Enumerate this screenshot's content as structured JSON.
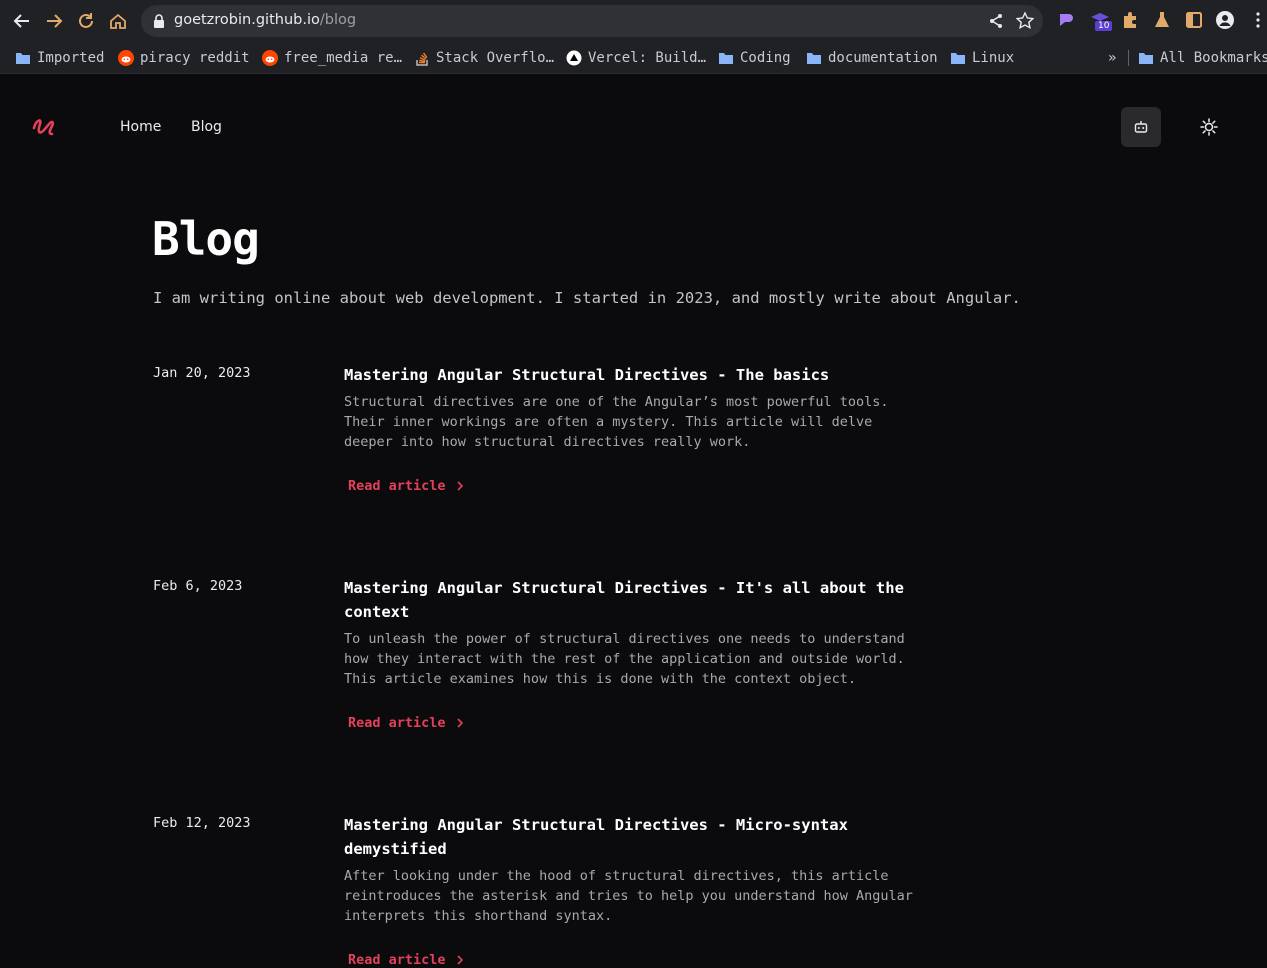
{
  "browser": {
    "url_host": "goetzrobin.github.io",
    "url_path": "/blog",
    "extension_badge": "10",
    "bookmarks": [
      {
        "label": "Imported",
        "icon": "folder-icon"
      },
      {
        "label": "piracy reddit",
        "icon": "reddit-icon"
      },
      {
        "label": "free_media re…",
        "icon": "reddit-icon"
      },
      {
        "label": "Stack Overflo…",
        "icon": "stackoverflow-icon"
      },
      {
        "label": "Vercel: Build…",
        "icon": "vercel-icon"
      },
      {
        "label": "Coding",
        "icon": "folder-icon"
      },
      {
        "label": "documentation",
        "icon": "folder-icon"
      },
      {
        "label": "Linux",
        "icon": "folder-icon"
      }
    ],
    "overflow_label": "»",
    "all_bookmarks_label": "All Bookmarks"
  },
  "site": {
    "nav": {
      "home": "Home",
      "blog": "Blog"
    },
    "colors": {
      "accent": "#e2415a",
      "background": "#0b0a0d"
    }
  },
  "page": {
    "title": "Blog",
    "intro": "I am writing online about web development. I started in 2023, and mostly write about Angular."
  },
  "posts": [
    {
      "date": "Jan 20, 2023",
      "title": "Mastering Angular Structural Directives - The basics",
      "excerpt": "Structural directives are one of the Angular’s most powerful tools. Their inner workings are often a mystery. This article will delve deeper into how structural directives really work.",
      "link_label": "Read article"
    },
    {
      "date": "Feb 6, 2023",
      "title": "Mastering Angular Structural Directives - It's all about the context",
      "excerpt": "To unleash the power of structural directives one needs to understand how they interact with the rest of the application and outside world. This article examines how this is done with the context object.",
      "link_label": "Read article"
    },
    {
      "date": "Feb 12, 2023",
      "title": "Mastering Angular Structural Directives - Micro-syntax demystified",
      "excerpt": "After looking under the hood of structural directives, this article reintroduces the asterisk and tries to help you understand how Angular interprets this shorthand syntax.",
      "link_label": "Read article"
    }
  ]
}
